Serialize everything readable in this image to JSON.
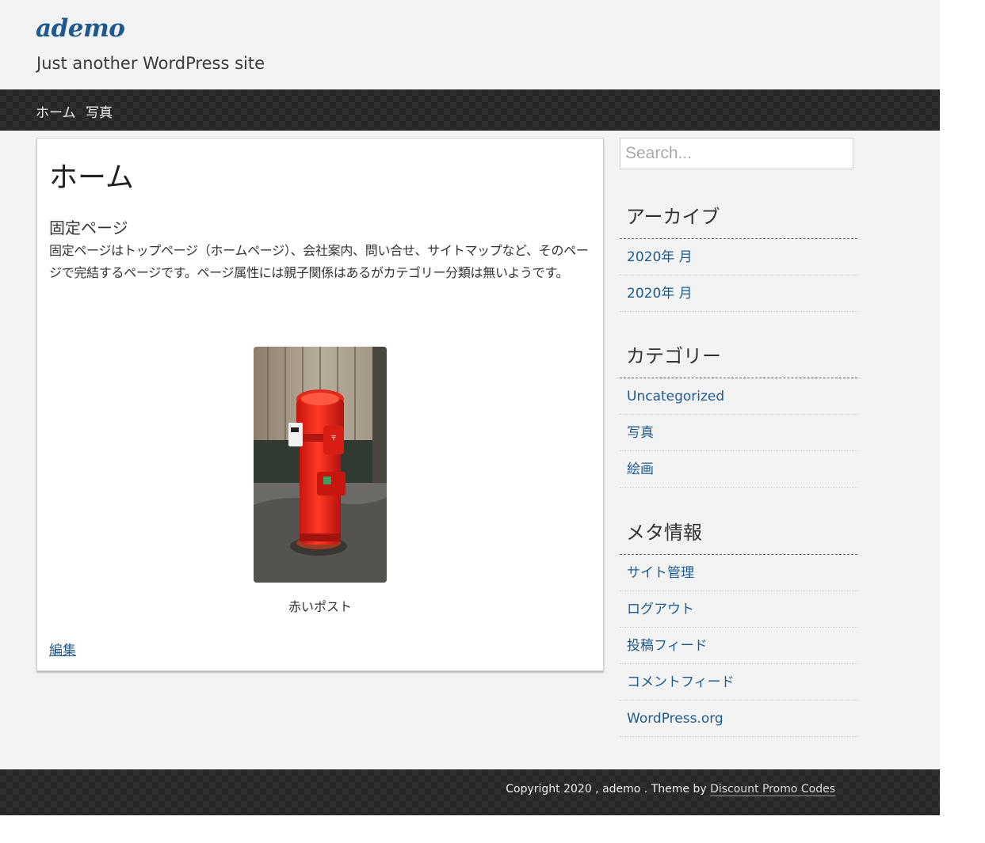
{
  "site": {
    "title": "ademo",
    "description": "Just another WordPress site"
  },
  "nav": {
    "items": [
      {
        "label": "ホーム"
      },
      {
        "label": "写真"
      }
    ]
  },
  "content": {
    "title": "ホーム",
    "subheading": "固定ページ",
    "body": "固定ページはトップページ（ホームページ）、会社案内、問い合せ、サイトマップなど、そのページで完結するページです。ページ属性には親子関係はあるがカテゴリー分類は無いようです。",
    "image_caption": "赤いポスト",
    "edit_label": "編集"
  },
  "sidebar": {
    "search_placeholder": "Search...",
    "archives": {
      "title": "アーカイブ",
      "items": [
        "2020年  月",
        "2020年  月"
      ]
    },
    "categories": {
      "title": "カテゴリー",
      "items": [
        "Uncategorized",
        "写真",
        "絵画"
      ]
    },
    "meta": {
      "title": "メタ情報",
      "items": [
        "サイト管理",
        "ログアウト",
        "投稿フィード",
        "コメントフィード",
        "WordPress.org"
      ]
    }
  },
  "footer": {
    "copyright": "Copyright 2020 , ademo . Theme by ",
    "theme_link": "Discount Promo Codes"
  },
  "colors": {
    "link": "#1e5a8e",
    "background": "#f3f3f3",
    "bar": "#262626",
    "postbox": "#e8241c"
  },
  "icons": {
    "photo": "red-mailbox-photo"
  }
}
